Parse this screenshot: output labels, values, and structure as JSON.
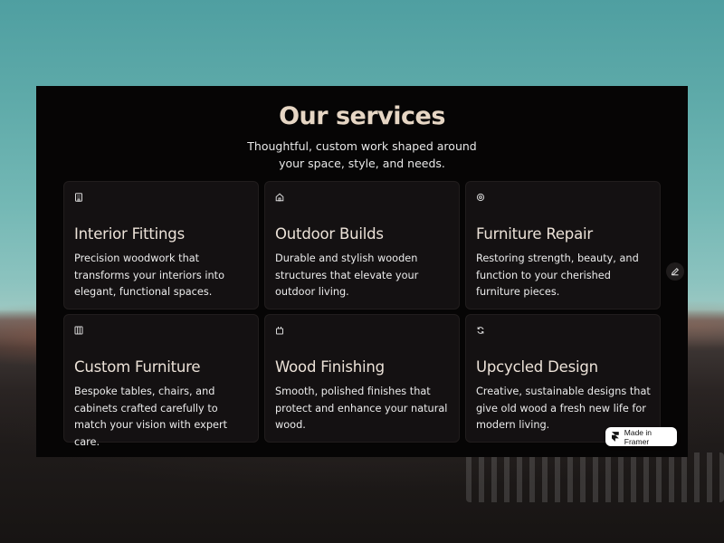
{
  "section": {
    "title": "Our services",
    "subtitle": "Thoughtful, custom work shaped around your space, style, and needs."
  },
  "services": [
    {
      "icon": "building-icon",
      "title": "Interior Fittings",
      "description": "Precision woodwork that transforms your interiors into elegant, functional spaces."
    },
    {
      "icon": "house-icon",
      "title": "Outdoor Builds",
      "description": "Durable and stylish wooden structures that elevate your outdoor living."
    },
    {
      "icon": "settings-icon",
      "title": "Furniture Repair",
      "description": "Restoring strength, beauty, and function to your cherished furniture pieces."
    },
    {
      "icon": "cabinet-icon",
      "title": "Custom Furniture",
      "description": "Bespoke tables, chairs, and cabinets crafted carefully to match your vision with expert care."
    },
    {
      "icon": "paint-bucket-icon",
      "title": "Wood Finishing",
      "description": "Smooth, polished finishes that protect and enhance your natural wood."
    },
    {
      "icon": "recycle-icon",
      "title": "Upcycled Design",
      "description": "Creative, sustainable designs that give old wood a fresh new life for modern living."
    }
  ],
  "badge": {
    "label": "Made in Framer"
  },
  "colors": {
    "panel": "#060505",
    "card": "#141112",
    "heading": "#e6d6c4"
  }
}
